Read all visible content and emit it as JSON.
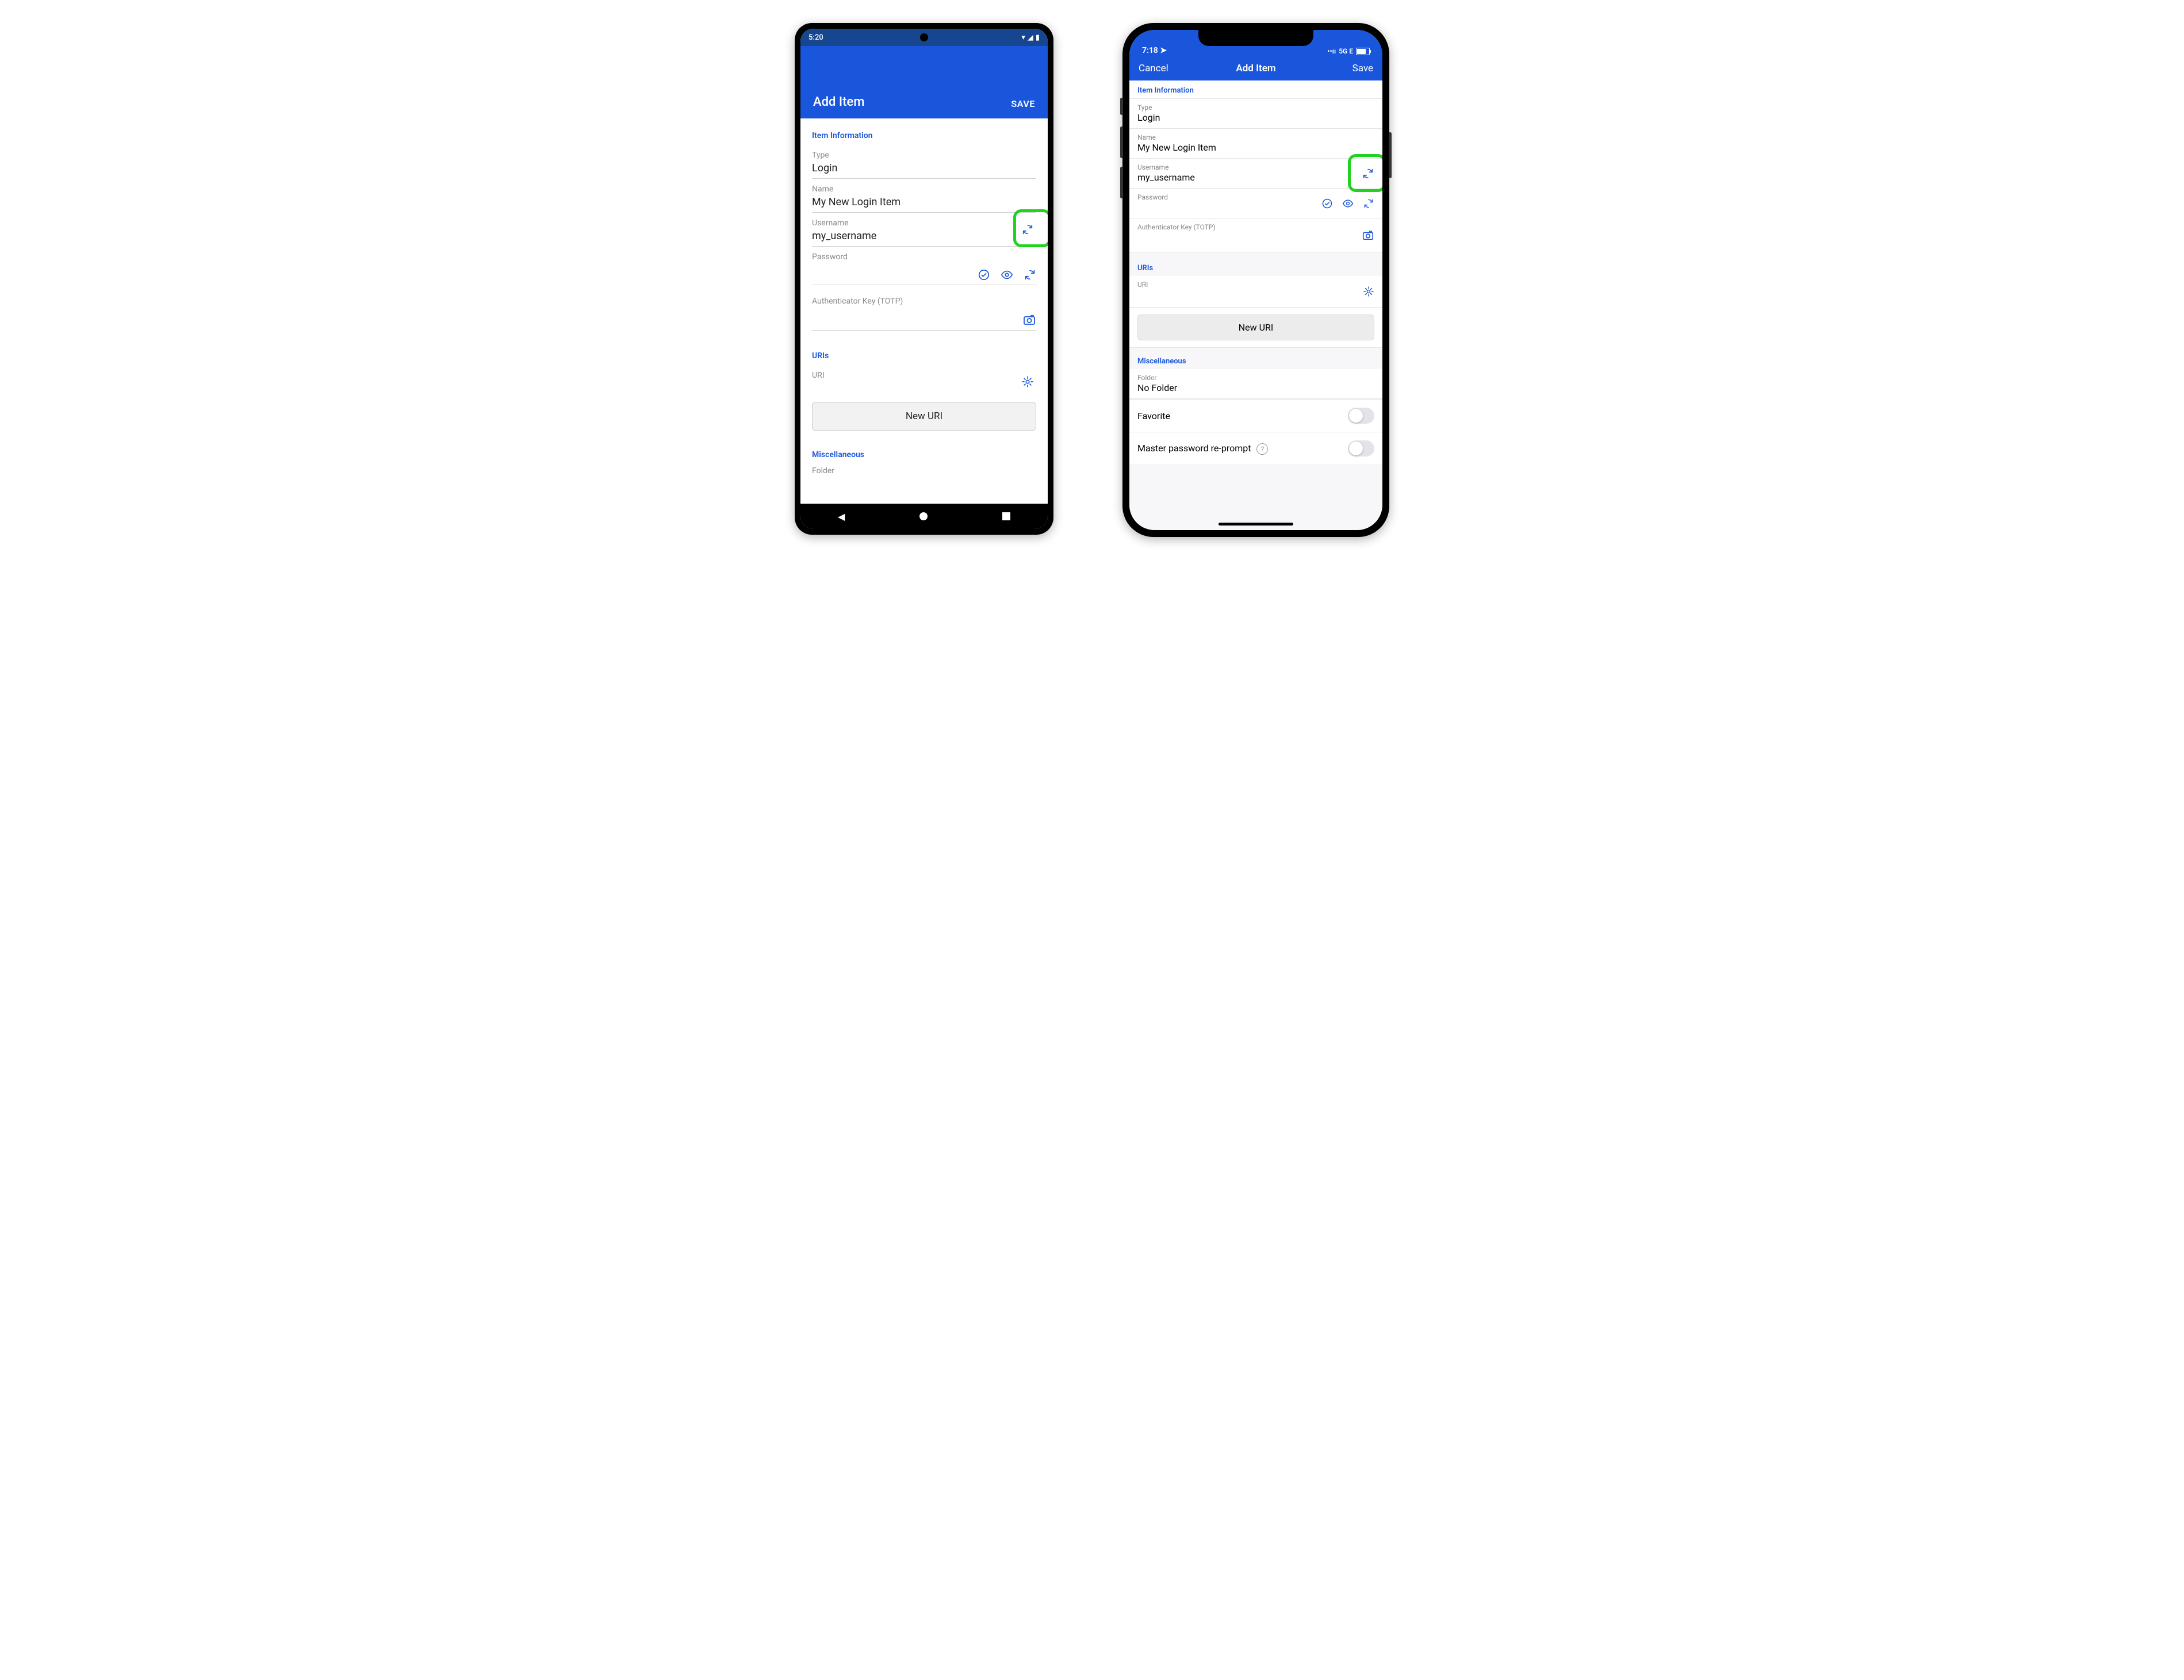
{
  "android": {
    "status": {
      "time": "5:20"
    },
    "header": {
      "title": "Add Item",
      "save": "SAVE"
    },
    "section_item_info": "Item Information",
    "type_label": "Type",
    "type_value": "Login",
    "name_label": "Name",
    "name_value": "My New Login Item",
    "username_label": "Username",
    "username_value": "my_username",
    "password_label": "Password",
    "password_value": "",
    "totp_label": "Authenticator Key (TOTP)",
    "section_uris": "URIs",
    "uri_label": "URI",
    "new_uri_button": "New URI",
    "section_misc": "Miscellaneous",
    "folder_label": "Folder"
  },
  "ios": {
    "status": {
      "time": "7:18",
      "network": "5G E"
    },
    "nav": {
      "cancel": "Cancel",
      "title": "Add Item",
      "save": "Save"
    },
    "section_item_info": "Item Information",
    "type_label": "Type",
    "type_value": "Login",
    "name_label": "Name",
    "name_value": "My New Login Item",
    "username_label": "Username",
    "username_value": "my_username",
    "password_label": "Password",
    "password_value": "",
    "totp_label": "Authenticator Key (TOTP)",
    "section_uris": "URIs",
    "uri_label": "URI",
    "new_uri_button": "New URI",
    "section_misc": "Miscellaneous",
    "folder_label": "Folder",
    "folder_value": "No Folder",
    "favorite_label": "Favorite",
    "reprompt_label": "Master password re-prompt"
  },
  "colors": {
    "primary": "#1a56db",
    "highlight": "#1fd31f"
  }
}
